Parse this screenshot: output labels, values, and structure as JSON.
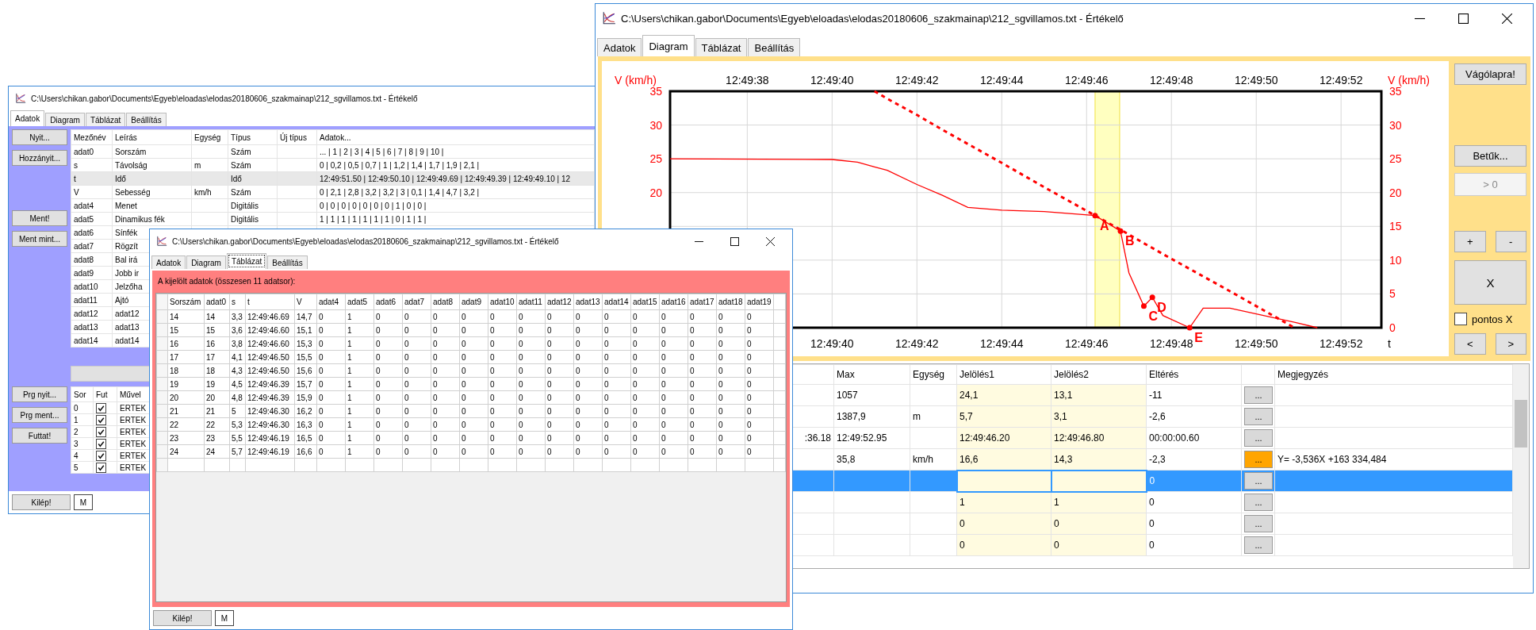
{
  "back_window": {
    "title": "C:\\Users\\chikan.gabor\\Documents\\Egyeb\\eloadas\\elodas20180606_szakmainap\\212_sgvillamos.txt - Értékelő",
    "tabs": [
      {
        "label": "Adatok",
        "selected": true
      },
      {
        "label": "Diagram",
        "selected": false
      },
      {
        "label": "Táblázat",
        "selected": false
      },
      {
        "label": "Beállítás",
        "selected": false
      }
    ],
    "file_buttons": [
      [
        "Nyit...",
        "Hozzányit..."
      ],
      [
        "Ment!",
        "Ment mint..."
      ]
    ],
    "fields_table": {
      "columns": [
        "Mezőnév",
        "Leírás",
        "Egység",
        "Típus",
        "Új típus",
        "Adatok..."
      ],
      "rows": [
        {
          "selected": false,
          "cells": [
            "adat0",
            "Sorszám",
            null,
            "Szám",
            null,
            "... | 1 | 2 | 3 | 4 | 5 | 6 | 7 | 8 | 9 | 10 |"
          ]
        },
        {
          "selected": false,
          "cells": [
            "s",
            "Távolság",
            "m",
            "Szám",
            null,
            "0 | 0,2 | 0,5 | 0,7 | 1 | 1,2 | 1,4 | 1,7 | 1,9 | 2,1 |"
          ]
        },
        {
          "selected": true,
          "cells": [
            "t",
            "Idő",
            null,
            "Idő",
            null,
            "12:49:51.50 | 12:49:50.10 | 12:49:49.69 | 12:49:49.39 | 12:49:49.10 | 12"
          ]
        },
        {
          "selected": false,
          "cells": [
            "V",
            "Sebesség",
            "km/h",
            "Szám",
            null,
            "0 | 2,1 | 2,8 | 3,2 | 3,2 | 3 | 0,1 | 1,4 | 4,7 | 3,2 |"
          ]
        },
        {
          "selected": false,
          "cells": [
            "adat4",
            "Menet",
            null,
            "Digitális",
            null,
            "0 | 0 | 0 | 0 | 0 | 0 | 0 | 1 | 0 | 0 |"
          ]
        },
        {
          "selected": false,
          "cells": [
            "adat5",
            "Dinamikus fék",
            null,
            "Digitális",
            null,
            "1 | 1 | 1 | 1 | 1 | 1 | 1 | 0 | 1 | 1 |"
          ]
        },
        {
          "selected": false,
          "cells": [
            "adat6",
            "Sínfék"
          ]
        },
        {
          "selected": false,
          "cells": [
            "adat7",
            "Rögzít"
          ]
        },
        {
          "selected": false,
          "cells": [
            "adat8",
            "Bal irá"
          ]
        },
        {
          "selected": false,
          "cells": [
            "adat9",
            "Jobb ir"
          ]
        },
        {
          "selected": false,
          "cells": [
            "adat10",
            "Jelzőha"
          ]
        },
        {
          "selected": false,
          "cells": [
            "adat11",
            "Ajtó"
          ]
        },
        {
          "selected": false,
          "cells": [
            "adat12",
            "adat12"
          ]
        },
        {
          "selected": false,
          "cells": [
            "adat13",
            "adat13"
          ]
        },
        {
          "selected": false,
          "cells": [
            "adat14",
            "adat14"
          ]
        }
      ]
    },
    "program_buttons": [
      "Prg nyit...",
      "Prg ment...",
      "Futtat!"
    ],
    "program_table": {
      "columns": [
        "Sor",
        "Fut",
        "Művel"
      ],
      "rows": [
        {
          "row": "0",
          "checked": true,
          "operation": "ERTEK"
        },
        {
          "row": "1",
          "checked": true,
          "operation": "ERTEK"
        },
        {
          "row": "2",
          "checked": true,
          "operation": "ERTEK"
        },
        {
          "row": "3",
          "checked": true,
          "operation": "ERTEK"
        },
        {
          "row": "4",
          "checked": true,
          "operation": "ERTEK"
        },
        {
          "row": "5",
          "checked": true,
          "operation": "ERTEK"
        }
      ]
    },
    "footer_buttons": [
      "Kilép!",
      "M"
    ]
  },
  "chart_window": {
    "title": "C:\\Users\\chikan.gabor\\Documents\\Egyeb\\eloadas\\elodas20180606_szakmainap\\212_sgvillamos.txt - Értékelő",
    "tabs": [
      {
        "label": "Adatok",
        "selected": false
      },
      {
        "label": "Diagram",
        "selected": true
      },
      {
        "label": "Táblázat",
        "selected": false
      },
      {
        "label": "Beállítás",
        "selected": false
      }
    ],
    "diagram": {
      "left_axis_title": "V (km/h)",
      "left_axis_labels": [
        "35",
        "30",
        "25",
        "20"
      ],
      "bottom_axis_labels": [
        "12:49:40",
        "12:49:42",
        "12:49:44",
        "12:49:46",
        "12:49:48",
        "12:49:50",
        "12:49:52"
      ],
      "chart_data": {
        "type": "line",
        "xlabel": "t",
        "ylabel": "V (km/h)",
        "grid": true,
        "x": [
          46176.18,
          46180.0,
          46180.6,
          46181.0,
          46181.3,
          46182.0,
          46182.6,
          46183.2,
          46184.0,
          46185.0,
          46186.2,
          46186.8,
          46187.0,
          46187.35,
          46187.55,
          46187.8,
          46188.43,
          46188.75,
          46189.38,
          46190.9,
          46191.44
        ],
        "series": [
          {
            "color": "#ff0000",
            "line_style": "solid",
            "values": [
              25,
              24.9,
              24.5,
              23.8,
              23.3,
              21.2,
              19.6,
              17.8,
              17.4,
              17.2,
              16.6,
              14.3,
              8.1,
              3.2,
              4.5,
              1.8,
              0,
              2.9,
              2.9,
              0.8,
              0
            ]
          },
          {
            "color": "#ff0000",
            "line_style": "dashed",
            "values": [
              null,
              null,
              null,
              35.0,
              33.9,
              31.5,
              29.3,
              27.2,
              24.4,
              20.8,
              16.6,
              14.5,
              13.8,
              12.5,
              11.8,
              10.9,
              8.7,
              7.6,
              5.4,
              0.0,
              null
            ]
          }
        ],
        "xlim": [
          46176.18,
          46192.95
        ],
        "ylim": [
          0,
          35
        ],
        "xticks": [
          {
            "value": 46178,
            "label": "12:49:38"
          },
          {
            "value": 46180,
            "label": "12:49:40"
          },
          {
            "value": 46182,
            "label": "12:49:42"
          },
          {
            "value": 46184,
            "label": "12:49:44"
          },
          {
            "value": 46186,
            "label": "12:49:46"
          },
          {
            "value": 46188,
            "label": "12:49:48"
          },
          {
            "value": 46190,
            "label": "12:49:50"
          },
          {
            "value": 46192,
            "label": "12:49:52"
          }
        ],
        "yticks": [
          0,
          5,
          10,
          15,
          20,
          25,
          30,
          35
        ],
        "bands": [
          {
            "axis": "x",
            "from": 46186.2,
            "to": 46186.78
          }
        ],
        "annotations": [
          {
            "x": 46186.2,
            "y": 16.6,
            "text": "A"
          },
          {
            "x": 46186.8,
            "y": 14.3,
            "text": "B"
          },
          {
            "x": 46187.35,
            "y": 3.2,
            "text": "C"
          },
          {
            "x": 46187.55,
            "y": 4.5,
            "text": "D"
          },
          {
            "x": 46188.43,
            "y": 0,
            "text": "E"
          }
        ]
      }
    },
    "side_panel": [
      [
        {
          "kind": "button",
          "label": "Vágólapra!"
        }
      ],
      [
        {
          "kind": "button",
          "label": "Betűk..."
        },
        {
          "kind": "field",
          "label": "> 0",
          "disabled": true
        }
      ],
      [
        {
          "kind": "pair",
          "labels": [
            "+",
            "-"
          ]
        },
        {
          "kind": "big",
          "label": "X"
        },
        {
          "kind": "checkbox",
          "label": "pontos X",
          "checked": false
        },
        {
          "kind": "pair",
          "labels": [
            "<",
            ">"
          ]
        }
      ]
    ],
    "table": {
      "columns": [
        {
          "kind": "text"
        },
        {
          "kind": "text",
          "label": "Max"
        },
        {
          "kind": "text",
          "label": "Egység"
        },
        {
          "kind": "mark",
          "label": "Jelölés1"
        },
        {
          "kind": "mark",
          "label": "Jelölés2"
        },
        {
          "kind": "text",
          "label": "Eltérés"
        },
        {
          "kind": "button"
        },
        {
          "kind": "text",
          "label": "Megjegyzés"
        }
      ],
      "rows": [
        {
          "selected": false,
          "cells": [
            null,
            "1057",
            null,
            "24,1",
            "13,1",
            "-11",
            null,
            null
          ],
          "button": {
            "label": "...",
            "highlighted": false
          }
        },
        {
          "selected": false,
          "cells": [
            null,
            "1387,9",
            "m",
            "5,7",
            "3,1",
            "-2,6",
            null,
            null
          ],
          "button": {
            "label": "...",
            "highlighted": false
          }
        },
        {
          "selected": false,
          "cells": [
            ":36.18",
            "12:49:52.95",
            null,
            "12:49:46.20",
            "12:49:46.80",
            "00:00:00.60",
            null,
            null
          ],
          "button": {
            "label": "...",
            "highlighted": false
          }
        },
        {
          "selected": false,
          "cells": [
            null,
            "35,8",
            "km/h",
            "16,6",
            "14,3",
            "-2,3",
            null,
            "Y= -3,536X +163 334,484"
          ],
          "button": {
            "label": "...",
            "highlighted": true
          }
        },
        {
          "selected": true,
          "cells": [
            null,
            null,
            null,
            null,
            null,
            "0",
            null,
            null
          ],
          "button": {
            "label": "...",
            "highlighted": false
          }
        },
        {
          "selected": false,
          "cells": [
            null,
            null,
            null,
            "1",
            "1",
            "0",
            null,
            null
          ],
          "button": {
            "label": "...",
            "highlighted": false
          }
        },
        {
          "selected": false,
          "cells": [
            null,
            null,
            null,
            "0",
            "0",
            "0",
            null,
            null
          ],
          "button": {
            "label": "...",
            "highlighted": false
          }
        },
        {
          "selected": false,
          "cells": [
            null,
            null,
            null,
            "0",
            "0",
            "0",
            null,
            null
          ],
          "button": {
            "label": "...",
            "highlighted": false
          }
        }
      ]
    }
  },
  "table_window": {
    "title": "C:\\Users\\chikan.gabor\\Documents\\Egyeb\\eloadas\\elodas20180606_szakmainap\\212_sgvillamos.txt - Értékelő",
    "tabs": [
      {
        "label": "Adatok",
        "selected": false
      },
      {
        "label": "Diagram",
        "selected": false
      },
      {
        "label": "Táblázat",
        "selected": true
      },
      {
        "label": "Beállítás",
        "selected": false
      }
    ],
    "header": "A kijelölt adatok (összesen 11 adatsor):",
    "table": {
      "columns": [
        "Sorszám",
        "adat0",
        "s",
        "t",
        "V",
        "adat4",
        "adat5",
        "adat6",
        "adat7",
        "adat8",
        "adat9",
        "adat10",
        "adat11",
        "adat12",
        "adat13",
        "adat14",
        "adat15",
        "adat16",
        "adat17",
        "adat18",
        "adat19"
      ],
      "rows": [
        [
          "14",
          "14",
          "3,3",
          "12:49:46.69",
          "14,7",
          "0",
          "1",
          "0",
          "0",
          "0",
          "0",
          "0",
          "0",
          "0",
          "0",
          "0",
          "0",
          "0",
          "0",
          "0",
          "0"
        ],
        [
          "15",
          "15",
          "3,6",
          "12:49:46.60",
          "15,1",
          "0",
          "1",
          "0",
          "0",
          "0",
          "0",
          "0",
          "0",
          "0",
          "0",
          "0",
          "0",
          "0",
          "0",
          "0",
          "0"
        ],
        [
          "16",
          "16",
          "3,8",
          "12:49:46.60",
          "15,3",
          "0",
          "1",
          "0",
          "0",
          "0",
          "0",
          "0",
          "0",
          "0",
          "0",
          "0",
          "0",
          "0",
          "0",
          "0",
          "0"
        ],
        [
          "17",
          "17",
          "4,1",
          "12:49:46.50",
          "15,5",
          "0",
          "1",
          "0",
          "0",
          "0",
          "0",
          "0",
          "0",
          "0",
          "0",
          "0",
          "0",
          "0",
          "0",
          "0",
          "0"
        ],
        [
          "18",
          "18",
          "4,3",
          "12:49:46.50",
          "15,6",
          "0",
          "1",
          "0",
          "0",
          "0",
          "0",
          "0",
          "0",
          "0",
          "0",
          "0",
          "0",
          "0",
          "0",
          "0",
          "0"
        ],
        [
          "19",
          "19",
          "4,5",
          "12:49:46.39",
          "15,7",
          "0",
          "1",
          "0",
          "0",
          "0",
          "0",
          "0",
          "0",
          "0",
          "0",
          "0",
          "0",
          "0",
          "0",
          "0",
          "0"
        ],
        [
          "20",
          "20",
          "4,8",
          "12:49:46.39",
          "15,9",
          "0",
          "1",
          "0",
          "0",
          "0",
          "0",
          "0",
          "0",
          "0",
          "0",
          "0",
          "0",
          "0",
          "0",
          "0",
          "0"
        ],
        [
          "21",
          "21",
          "5",
          "12:49:46.30",
          "16,2",
          "0",
          "1",
          "0",
          "0",
          "0",
          "0",
          "0",
          "0",
          "0",
          "0",
          "0",
          "0",
          "0",
          "0",
          "0",
          "0"
        ],
        [
          "22",
          "22",
          "5,3",
          "12:49:46.30",
          "16,3",
          "0",
          "1",
          "0",
          "0",
          "0",
          "0",
          "0",
          "0",
          "0",
          "0",
          "0",
          "0",
          "0",
          "0",
          "0",
          "0"
        ],
        [
          "23",
          "23",
          "5,5",
          "12:49:46.19",
          "16,5",
          "0",
          "1",
          "0",
          "0",
          "0",
          "0",
          "0",
          "0",
          "0",
          "0",
          "0",
          "0",
          "0",
          "0",
          "0",
          "0"
        ],
        [
          "24",
          "24",
          "5,7",
          "12:49:46.19",
          "16,6",
          "0",
          "1",
          "0",
          "0",
          "0",
          "0",
          "0",
          "0",
          "0",
          "0",
          "0",
          "0",
          "0",
          "0",
          "0",
          "0"
        ]
      ]
    },
    "footer_buttons": [
      "Kilép!",
      "M"
    ]
  }
}
